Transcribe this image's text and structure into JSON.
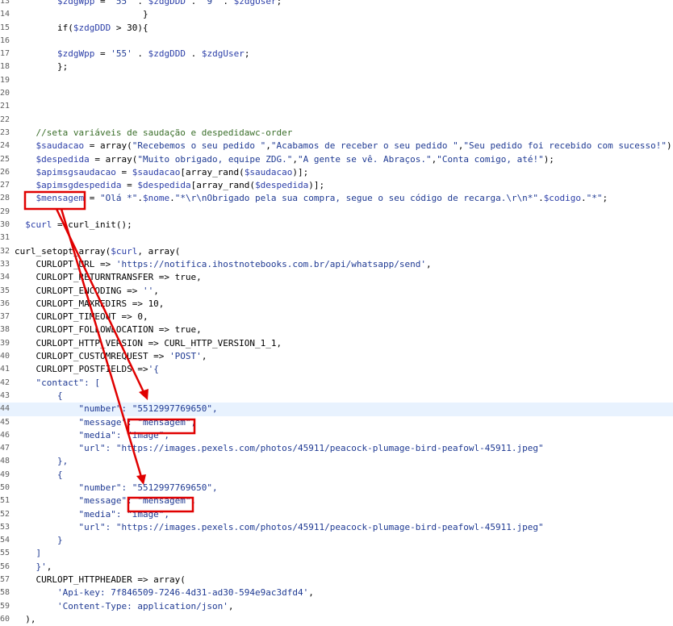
{
  "editor": {
    "highlighted_line": "44",
    "lines": [
      {
        "num": "13",
        "segments": [
          {
            "t": "        ",
            "c": "plain"
          },
          {
            "t": "$zdgWpp",
            "c": "var"
          },
          {
            "t": " = ",
            "c": "plain"
          },
          {
            "t": "'55'",
            "c": "str"
          },
          {
            "t": " . ",
            "c": "plain"
          },
          {
            "t": "$zdgDDD",
            "c": "var"
          },
          {
            "t": " . ",
            "c": "plain"
          },
          {
            "t": "'9'",
            "c": "str"
          },
          {
            "t": " . ",
            "c": "plain"
          },
          {
            "t": "$zdgUser",
            "c": "var"
          },
          {
            "t": ";",
            "c": "plain"
          }
        ]
      },
      {
        "num": "14",
        "segments": [
          {
            "t": "                        }",
            "c": "plain"
          }
        ]
      },
      {
        "num": "15",
        "segments": [
          {
            "t": "        if(",
            "c": "plain"
          },
          {
            "t": "$zdgDDD",
            "c": "var"
          },
          {
            "t": " > 30){",
            "c": "plain"
          }
        ]
      },
      {
        "num": "16",
        "segments": []
      },
      {
        "num": "17",
        "segments": [
          {
            "t": "        ",
            "c": "plain"
          },
          {
            "t": "$zdgWpp",
            "c": "var"
          },
          {
            "t": " = ",
            "c": "plain"
          },
          {
            "t": "'55'",
            "c": "str"
          },
          {
            "t": " . ",
            "c": "plain"
          },
          {
            "t": "$zdgDDD",
            "c": "var"
          },
          {
            "t": " . ",
            "c": "plain"
          },
          {
            "t": "$zdgUser",
            "c": "var"
          },
          {
            "t": ";",
            "c": "plain"
          }
        ]
      },
      {
        "num": "18",
        "segments": [
          {
            "t": "        };",
            "c": "plain"
          }
        ]
      },
      {
        "num": "19",
        "segments": []
      },
      {
        "num": "20",
        "segments": []
      },
      {
        "num": "21",
        "segments": []
      },
      {
        "num": "22",
        "segments": []
      },
      {
        "num": "23",
        "segments": [
          {
            "t": "    ",
            "c": "plain"
          },
          {
            "t": "//seta variáveis de saudação e despedidawc-order",
            "c": "cmt"
          }
        ]
      },
      {
        "num": "24",
        "segments": [
          {
            "t": "    ",
            "c": "plain"
          },
          {
            "t": "$saudacao",
            "c": "var"
          },
          {
            "t": " = array(",
            "c": "plain"
          },
          {
            "t": "\"Recebemos o seu pedido \"",
            "c": "str"
          },
          {
            "t": ",",
            "c": "plain"
          },
          {
            "t": "\"Acabamos de receber o seu pedido \"",
            "c": "str"
          },
          {
            "t": ",",
            "c": "plain"
          },
          {
            "t": "\"Seu pedido foi recebido com sucesso!\"",
            "c": "str"
          },
          {
            "t": ");",
            "c": "plain"
          }
        ]
      },
      {
        "num": "25",
        "segments": [
          {
            "t": "    ",
            "c": "plain"
          },
          {
            "t": "$despedida",
            "c": "var"
          },
          {
            "t": " = array(",
            "c": "plain"
          },
          {
            "t": "\"Muito obrigado, equipe ZDG.\"",
            "c": "str"
          },
          {
            "t": ",",
            "c": "plain"
          },
          {
            "t": "\"A gente se vê. Abraços.\"",
            "c": "str"
          },
          {
            "t": ",",
            "c": "plain"
          },
          {
            "t": "\"Conta comigo, até!\"",
            "c": "str"
          },
          {
            "t": ");",
            "c": "plain"
          }
        ]
      },
      {
        "num": "26",
        "segments": [
          {
            "t": "    ",
            "c": "plain"
          },
          {
            "t": "$apimsgsaudacao",
            "c": "var"
          },
          {
            "t": " = ",
            "c": "plain"
          },
          {
            "t": "$saudacao",
            "c": "var"
          },
          {
            "t": "[array_rand(",
            "c": "plain"
          },
          {
            "t": "$saudacao",
            "c": "var"
          },
          {
            "t": ")];",
            "c": "plain"
          }
        ]
      },
      {
        "num": "27",
        "segments": [
          {
            "t": "    ",
            "c": "plain"
          },
          {
            "t": "$apimsgdespedida",
            "c": "var"
          },
          {
            "t": " = ",
            "c": "plain"
          },
          {
            "t": "$despedida",
            "c": "var"
          },
          {
            "t": "[array_rand(",
            "c": "plain"
          },
          {
            "t": "$despedida",
            "c": "var"
          },
          {
            "t": ")];",
            "c": "plain"
          }
        ]
      },
      {
        "num": "28",
        "segments": [
          {
            "t": "    ",
            "c": "plain"
          },
          {
            "t": "$mensagem",
            "c": "var"
          },
          {
            "t": " = ",
            "c": "plain"
          },
          {
            "t": "\"Olá *\"",
            "c": "str"
          },
          {
            "t": ".",
            "c": "plain"
          },
          {
            "t": "$nome",
            "c": "var"
          },
          {
            "t": ".",
            "c": "plain"
          },
          {
            "t": "\"*\\r\\nObrigado pela sua compra, segue o seu código de recarga.\\r\\n*\"",
            "c": "str"
          },
          {
            "t": ".",
            "c": "plain"
          },
          {
            "t": "$codigo",
            "c": "var"
          },
          {
            "t": ".",
            "c": "plain"
          },
          {
            "t": "\"*\"",
            "c": "str"
          },
          {
            "t": ";",
            "c": "plain"
          }
        ]
      },
      {
        "num": "29",
        "segments": []
      },
      {
        "num": "30",
        "segments": [
          {
            "t": "  ",
            "c": "plain"
          },
          {
            "t": "$curl",
            "c": "var"
          },
          {
            "t": " = curl_init();",
            "c": "plain"
          }
        ]
      },
      {
        "num": "31",
        "segments": []
      },
      {
        "num": "32",
        "segments": [
          {
            "t": "curl_setopt_array(",
            "c": "plain"
          },
          {
            "t": "$curl",
            "c": "var"
          },
          {
            "t": ", array(",
            "c": "plain"
          }
        ]
      },
      {
        "num": "33",
        "segments": [
          {
            "t": "    CURLOPT_URL => ",
            "c": "plain"
          },
          {
            "t": "'https://notifica.ihostnotebooks.com.br/api/whatsapp/send'",
            "c": "str"
          },
          {
            "t": ",",
            "c": "plain"
          }
        ]
      },
      {
        "num": "34",
        "segments": [
          {
            "t": "    CURLOPT_RETURNTRANSFER => true,",
            "c": "plain"
          }
        ]
      },
      {
        "num": "35",
        "segments": [
          {
            "t": "    CURLOPT_ENCODING => ",
            "c": "plain"
          },
          {
            "t": "''",
            "c": "str"
          },
          {
            "t": ",",
            "c": "plain"
          }
        ]
      },
      {
        "num": "36",
        "segments": [
          {
            "t": "    CURLOPT_MAXREDIRS => 10,",
            "c": "plain"
          }
        ]
      },
      {
        "num": "37",
        "segments": [
          {
            "t": "    CURLOPT_TIMEOUT => 0,",
            "c": "plain"
          }
        ]
      },
      {
        "num": "38",
        "segments": [
          {
            "t": "    CURLOPT_FOLLOWLOCATION => true,",
            "c": "plain"
          }
        ]
      },
      {
        "num": "39",
        "segments": [
          {
            "t": "    CURLOPT_HTTP_VERSION => CURL_HTTP_VERSION_1_1,",
            "c": "plain"
          }
        ]
      },
      {
        "num": "40",
        "segments": [
          {
            "t": "    CURLOPT_CUSTOMREQUEST => ",
            "c": "plain"
          },
          {
            "t": "'POST'",
            "c": "str"
          },
          {
            "t": ",",
            "c": "plain"
          }
        ]
      },
      {
        "num": "41",
        "segments": [
          {
            "t": "    CURLOPT_POSTFIELDS =>",
            "c": "plain"
          },
          {
            "t": "'{",
            "c": "str"
          }
        ]
      },
      {
        "num": "42",
        "segments": [
          {
            "t": "    \"contact\": [",
            "c": "str"
          }
        ]
      },
      {
        "num": "43",
        "segments": [
          {
            "t": "        {",
            "c": "str"
          }
        ]
      },
      {
        "num": "44",
        "segments": [
          {
            "t": "            \"number\": \"5512997769650\",",
            "c": "str"
          }
        ]
      },
      {
        "num": "45",
        "segments": [
          {
            "t": "            \"message\": \"mensagem\",",
            "c": "str"
          }
        ]
      },
      {
        "num": "46",
        "segments": [
          {
            "t": "            \"media\": \"image\",",
            "c": "str"
          }
        ]
      },
      {
        "num": "47",
        "segments": [
          {
            "t": "            \"url\": \"https://images.pexels.com/photos/45911/peacock-plumage-bird-peafowl-45911.jpeg\"",
            "c": "str"
          }
        ]
      },
      {
        "num": "48",
        "segments": [
          {
            "t": "        },",
            "c": "str"
          }
        ]
      },
      {
        "num": "49",
        "segments": [
          {
            "t": "        {",
            "c": "str"
          }
        ]
      },
      {
        "num": "50",
        "segments": [
          {
            "t": "            \"number\": \"5512997769650\",",
            "c": "str"
          }
        ]
      },
      {
        "num": "51",
        "segments": [
          {
            "t": "            \"message\": \"mensagem\",",
            "c": "str"
          }
        ]
      },
      {
        "num": "52",
        "segments": [
          {
            "t": "            \"media\": \"image\",",
            "c": "str"
          }
        ]
      },
      {
        "num": "53",
        "segments": [
          {
            "t": "            \"url\": \"https://images.pexels.com/photos/45911/peacock-plumage-bird-peafowl-45911.jpeg\"",
            "c": "str"
          }
        ]
      },
      {
        "num": "54",
        "segments": [
          {
            "t": "        }",
            "c": "str"
          }
        ]
      },
      {
        "num": "55",
        "segments": [
          {
            "t": "    ]",
            "c": "str"
          }
        ]
      },
      {
        "num": "56",
        "segments": [
          {
            "t": "    }'",
            "c": "str"
          },
          {
            "t": ",",
            "c": "plain"
          }
        ]
      },
      {
        "num": "57",
        "segments": [
          {
            "t": "    CURLOPT_HTTPHEADER => array(",
            "c": "plain"
          }
        ]
      },
      {
        "num": "58",
        "segments": [
          {
            "t": "        ",
            "c": "plain"
          },
          {
            "t": "'Api-key: 7f846509-7246-4d31-ad30-594e9ac3dfd4'",
            "c": "str"
          },
          {
            "t": ",",
            "c": "plain"
          }
        ]
      },
      {
        "num": "59",
        "segments": [
          {
            "t": "        ",
            "c": "plain"
          },
          {
            "t": "'Content-Type: application/json'",
            "c": "str"
          },
          {
            "t": ",",
            "c": "plain"
          }
        ]
      },
      {
        "num": "60",
        "segments": [
          {
            "t": "  ),",
            "c": "plain"
          }
        ]
      }
    ]
  },
  "annotation": {
    "color": "#e00000"
  }
}
